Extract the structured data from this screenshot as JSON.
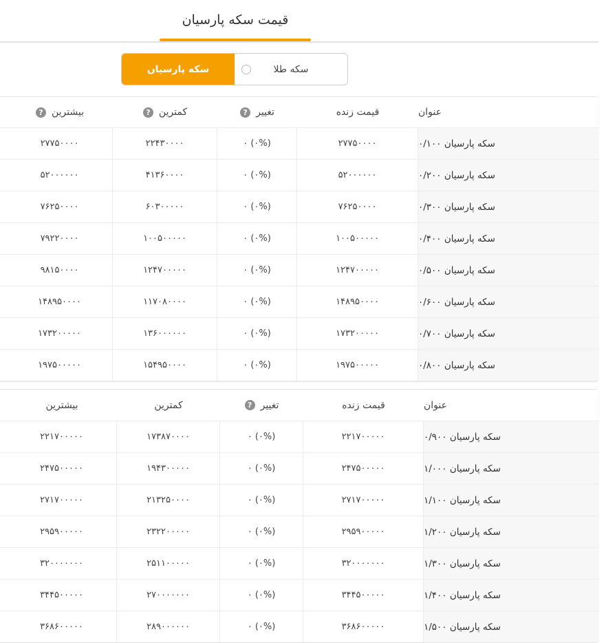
{
  "header": {
    "title": "قیمت سکه پارسیان"
  },
  "toggle": {
    "active": "سکه پارسیان",
    "inactive": "سکه طلا"
  },
  "help_glyph": "?",
  "table1": {
    "headers": {
      "title": "عنوان",
      "live": "قیمت زنده",
      "change": "تغییر",
      "min": "کمترین",
      "max": "بیشترین"
    },
    "rows": [
      {
        "title": "سکه پارسیان ۰/۱۰۰",
        "live": "۲۷۷۵۰۰۰۰",
        "change": "۰ (۰%)",
        "min": "۲۲۴۳۰۰۰۰",
        "max": "۲۷۷۵۰۰۰۰"
      },
      {
        "title": "سکه پارسیان ۰/۲۰۰",
        "live": "۵۲۰۰۰۰۰۰",
        "change": "۰ (۰%)",
        "min": "۴۱۳۶۰۰۰۰",
        "max": "۵۲۰۰۰۰۰۰"
      },
      {
        "title": "سکه پارسیان ۰/۳۰۰",
        "live": "۷۶۲۵۰۰۰۰",
        "change": "۰ (۰%)",
        "min": "۶۰۳۰۰۰۰۰",
        "max": "۷۶۲۵۰۰۰۰"
      },
      {
        "title": "سکه پارسیان ۰/۴۰۰",
        "live": "۱۰۰۵۰۰۰۰۰",
        "change": "۰ (۰%)",
        "min": "۱۰۰۵۰۰۰۰۰",
        "max": "۷۹۲۲۰۰۰۰"
      },
      {
        "title": "سکه پارسیان ۰/۵۰۰",
        "live": "۱۲۴۷۰۰۰۰۰",
        "change": "۰ (۰%)",
        "min": "۱۲۴۷۰۰۰۰۰",
        "max": "۹۸۱۵۰۰۰۰"
      },
      {
        "title": "سکه پارسیان ۰/۶۰۰",
        "live": "۱۴۸۹۵۰۰۰۰",
        "change": "۰ (۰%)",
        "min": "۱۱۷۰۸۰۰۰۰",
        "max": "۱۴۸۹۵۰۰۰۰"
      },
      {
        "title": "سکه پارسیان ۰/۷۰۰",
        "live": "۱۷۳۲۰۰۰۰۰",
        "change": "۰ (۰%)",
        "min": "۱۳۶۰۰۰۰۰۰",
        "max": "۱۷۳۲۰۰۰۰۰"
      },
      {
        "title": "سکه پارسیان ۰/۸۰۰",
        "live": "۱۹۷۵۰۰۰۰۰",
        "change": "۰ (۰%)",
        "min": "۱۵۴۹۵۰۰۰۰",
        "max": "۱۹۷۵۰۰۰۰۰"
      }
    ]
  },
  "table2": {
    "headers": {
      "title": "عنوان",
      "live": "قیمت زنده",
      "change": "تغییر",
      "min": "کمترین",
      "max": "بیشترین"
    },
    "rows": [
      {
        "title": "سکه پارسیان ۰/۹۰۰",
        "live": "۲۲۱۷۰۰۰۰۰",
        "change": "۰ (۰%)",
        "min": "۱۷۳۸۷۰۰۰۰",
        "max": "۲۲۱۷۰۰۰۰۰"
      },
      {
        "title": "سکه پارسیان ۱/۰۰۰",
        "live": "۲۴۷۵۰۰۰۰۰",
        "change": "۰ (۰%)",
        "min": "۱۹۴۳۰۰۰۰۰",
        "max": "۲۴۷۵۰۰۰۰۰"
      },
      {
        "title": "سکه پارسیان ۱/۱۰۰",
        "live": "۲۷۱۷۰۰۰۰۰",
        "change": "۰ (۰%)",
        "min": "۲۱۳۲۵۰۰۰۰",
        "max": "۲۷۱۷۰۰۰۰۰"
      },
      {
        "title": "سکه پارسیان ۱/۲۰۰",
        "live": "۲۹۵۹۰۰۰۰۰",
        "change": "۰ (۰%)",
        "min": "۲۳۲۲۰۰۰۰۰",
        "max": "۲۹۵۹۰۰۰۰۰"
      },
      {
        "title": "سکه پارسیان ۱/۳۰۰",
        "live": "۳۲۰۰۰۰۰۰۰",
        "change": "۰ (۰%)",
        "min": "۲۵۱۱۰۰۰۰۰",
        "max": "۳۲۰۰۰۰۰۰۰"
      },
      {
        "title": "سکه پارسیان ۱/۴۰۰",
        "live": "۳۴۴۵۰۰۰۰۰",
        "change": "۰ (۰%)",
        "min": "۲۷۰۰۰۰۰۰۰",
        "max": "۳۴۴۵۰۰۰۰۰"
      },
      {
        "title": "سکه پارسیان ۱/۵۰۰",
        "live": "۳۶۸۶۰۰۰۰۰",
        "change": "۰ (۰%)",
        "min": "۲۸۹۰۰۰۰۰۰",
        "max": "۳۶۸۶۰۰۰۰۰"
      }
    ]
  }
}
